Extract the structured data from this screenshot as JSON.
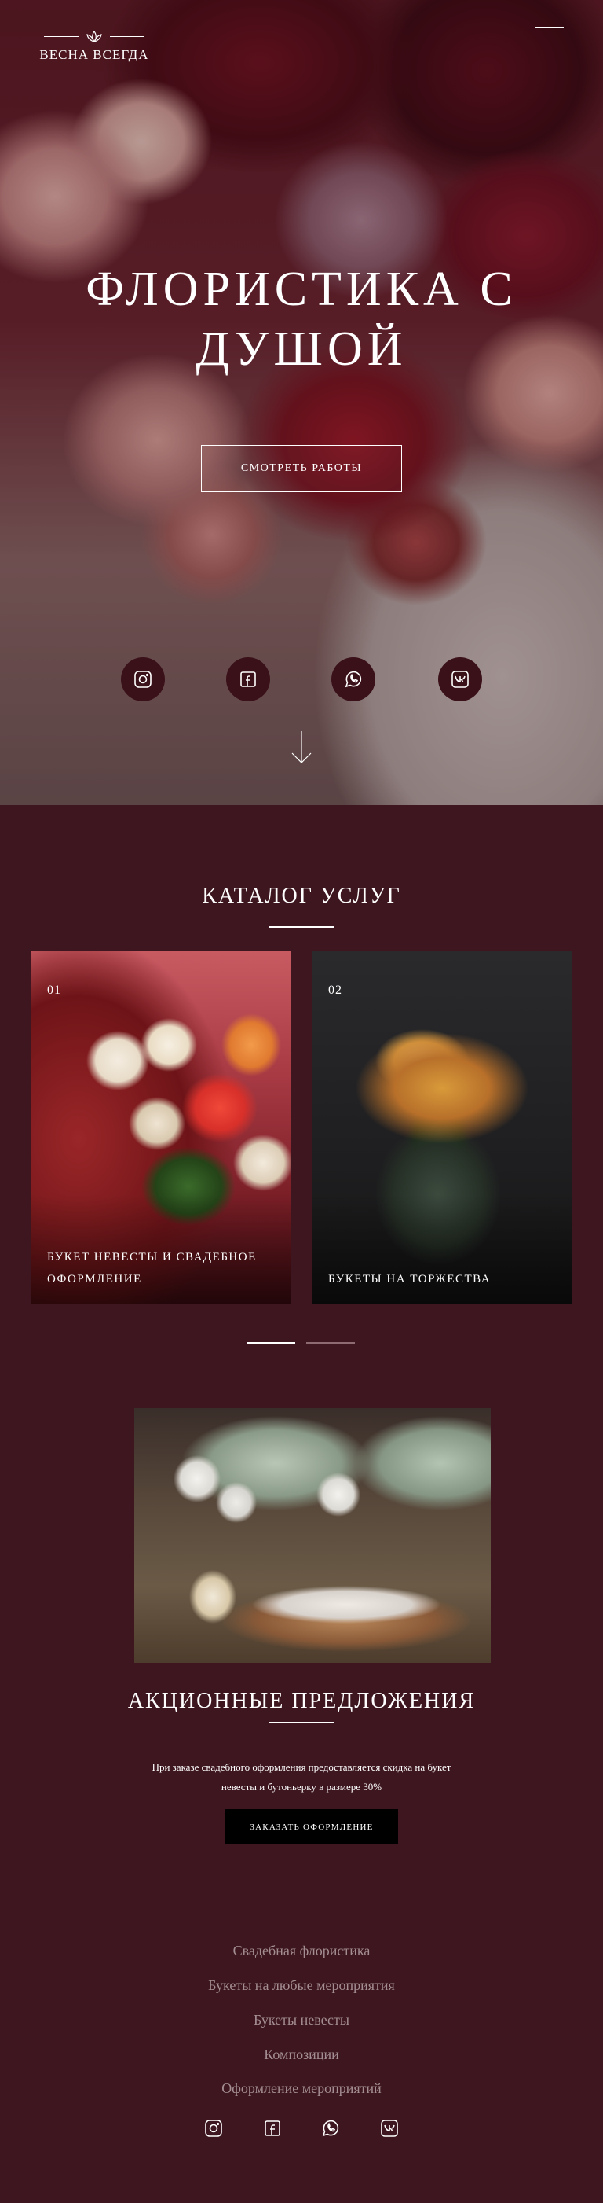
{
  "brand": {
    "name": "ВЕСНА ВСЕГДА"
  },
  "hero": {
    "title_line1": "ФЛОРИСТИКА С",
    "title_line2": "ДУШОЙ",
    "cta_label": "СМОТРЕТЬ РАБОТЫ",
    "social": [
      "instagram-icon",
      "facebook-icon",
      "whatsapp-icon",
      "vk-icon"
    ]
  },
  "catalog": {
    "title": "КАТАЛОГ УСЛУГ",
    "cards": [
      {
        "num": "01",
        "label": "БУКЕТ НЕВЕСТЫ И СВАДЕБНОЕ ОФОРМЛЕНИЕ"
      },
      {
        "num": "02",
        "label": "БУКЕТЫ НА ТОРЖЕСТВА"
      }
    ],
    "active_slide": 1,
    "slide_count": 2
  },
  "promo": {
    "title": "АКЦИОННЫЕ ПРЕДЛОЖЕНИЯ",
    "text": "При заказе свадебного оформления предоставляется скидка на букет невесты и бутоньерку в размере 30%",
    "cta_label": "ЗАКАЗАТЬ ОФОРМЛЕНИЕ"
  },
  "footer": {
    "nav": [
      "Свадебная флористика",
      "Букеты на любые мероприятия",
      "Букеты невесты",
      "Композиции",
      "Оформление мероприятий"
    ],
    "social": [
      "instagram-icon",
      "facebook-icon",
      "whatsapp-icon",
      "vk-icon"
    ]
  },
  "colors": {
    "background": "#3d161f",
    "social_circle": "#3a1019",
    "footer_link": "#a48e93",
    "promo_button": "#000000"
  }
}
